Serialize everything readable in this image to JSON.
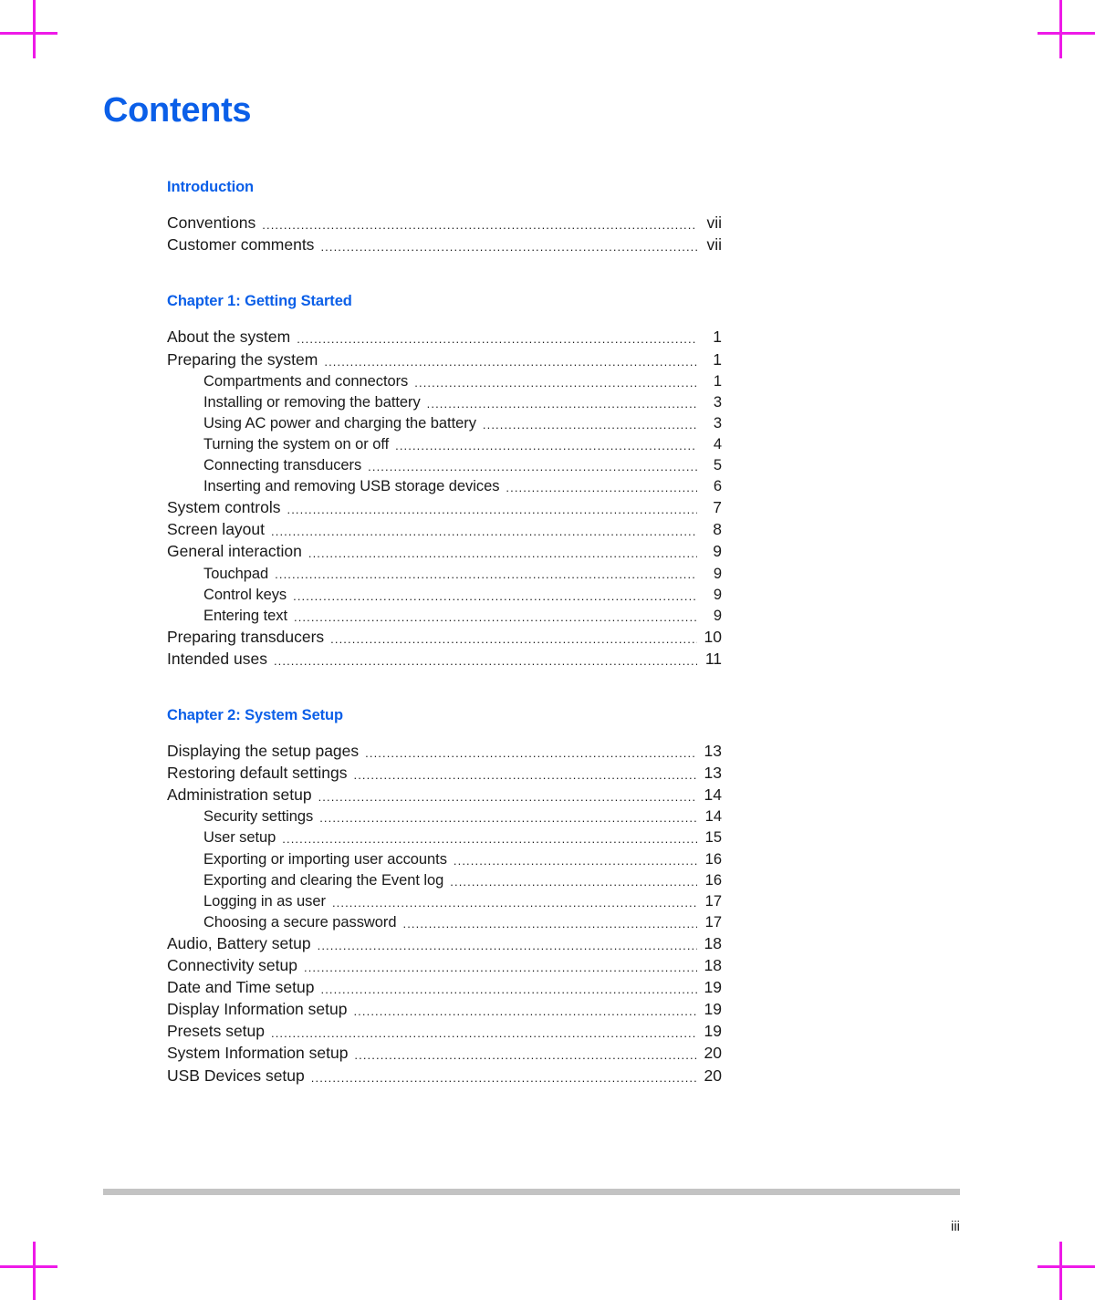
{
  "document": {
    "title": "Contents",
    "folio": "iii",
    "accent_color": "#0b5fe8",
    "rule_color": "#c3c3c3",
    "crop_mark_color": "#ee1ae8"
  },
  "sections": [
    {
      "heading": "Introduction",
      "entries": [
        {
          "label": "Conventions",
          "page": "vii",
          "level": 1
        },
        {
          "label": "Customer comments",
          "page": "vii",
          "level": 1
        }
      ]
    },
    {
      "heading": "Chapter 1: Getting Started",
      "entries": [
        {
          "label": "About the system",
          "page": "1",
          "level": 1
        },
        {
          "label": "Preparing the system",
          "page": "1",
          "level": 1
        },
        {
          "label": "Compartments and connectors",
          "page": "1",
          "level": 2
        },
        {
          "label": "Installing or removing the battery",
          "page": "3",
          "level": 2
        },
        {
          "label": "Using AC power and charging the battery",
          "page": "3",
          "level": 2
        },
        {
          "label": "Turning the system on or off",
          "page": "4",
          "level": 2
        },
        {
          "label": "Connecting transducers",
          "page": "5",
          "level": 2
        },
        {
          "label": "Inserting and removing USB storage devices",
          "page": "6",
          "level": 2
        },
        {
          "label": "System controls",
          "page": "7",
          "level": 1
        },
        {
          "label": "Screen layout",
          "page": "8",
          "level": 1
        },
        {
          "label": "General interaction",
          "page": "9",
          "level": 1
        },
        {
          "label": "Touchpad",
          "page": "9",
          "level": 2
        },
        {
          "label": "Control keys",
          "page": "9",
          "level": 2
        },
        {
          "label": "Entering text",
          "page": "9",
          "level": 2
        },
        {
          "label": "Preparing transducers",
          "page": "10",
          "level": 1
        },
        {
          "label": "Intended uses",
          "page": "11",
          "level": 1
        }
      ]
    },
    {
      "heading": "Chapter 2: System Setup",
      "entries": [
        {
          "label": "Displaying the setup pages",
          "page": "13",
          "level": 1
        },
        {
          "label": "Restoring default settings",
          "page": "13",
          "level": 1
        },
        {
          "label": "Administration setup",
          "page": "14",
          "level": 1
        },
        {
          "label": "Security settings",
          "page": "14",
          "level": 2
        },
        {
          "label": "User setup",
          "page": "15",
          "level": 2
        },
        {
          "label": "Exporting or importing user accounts",
          "page": "16",
          "level": 2
        },
        {
          "label": "Exporting and clearing the Event log",
          "page": "16",
          "level": 2
        },
        {
          "label": "Logging in as user",
          "page": "17",
          "level": 2
        },
        {
          "label": "Choosing a secure password",
          "page": "17",
          "level": 2
        },
        {
          "label": "Audio, Battery setup",
          "page": "18",
          "level": 1
        },
        {
          "label": "Connectivity setup",
          "page": "18",
          "level": 1
        },
        {
          "label": "Date and Time setup",
          "page": "19",
          "level": 1
        },
        {
          "label": "Display Information setup",
          "page": "19",
          "level": 1
        },
        {
          "label": "Presets setup",
          "page": "19",
          "level": 1
        },
        {
          "label": "System Information setup",
          "page": "20",
          "level": 1
        },
        {
          "label": "USB Devices setup",
          "page": "20",
          "level": 1
        }
      ]
    }
  ]
}
